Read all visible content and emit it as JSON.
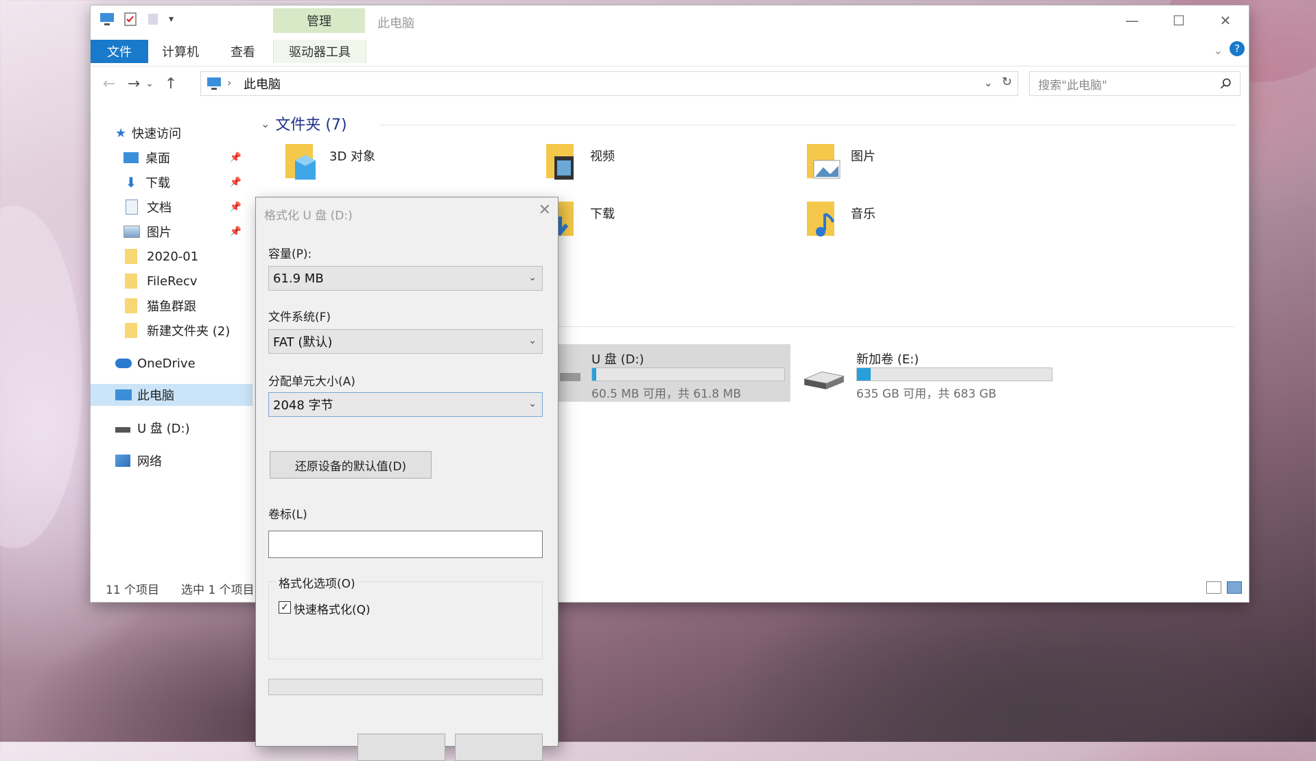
{
  "window": {
    "title": "此电脑",
    "context_tab": "管理",
    "tabs": [
      "文件",
      "计算机",
      "查看",
      "驱动器工具"
    ],
    "address": "此电脑",
    "search_placeholder": "搜索\"此电脑\""
  },
  "nav": {
    "quick_access": "快速访问",
    "items": [
      {
        "label": "桌面",
        "icon": "desktop-icon",
        "pinned": true
      },
      {
        "label": "下载",
        "icon": "download-arrow-icon",
        "pinned": true
      },
      {
        "label": "文档",
        "icon": "document-icon",
        "pinned": true
      },
      {
        "label": "图片",
        "icon": "pictures-icon",
        "pinned": true
      },
      {
        "label": "2020-01",
        "icon": "folder-icon",
        "pinned": false
      },
      {
        "label": "FileRecv",
        "icon": "folder-icon",
        "pinned": false
      },
      {
        "label": "猫鱼群跟",
        "icon": "folder-icon",
        "pinned": false
      },
      {
        "label": "新建文件夹 (2)",
        "icon": "folder-icon",
        "pinned": false
      }
    ],
    "onedrive": "OneDrive",
    "this_pc": "此电脑",
    "usb": "U 盘 (D:)",
    "network": "网络"
  },
  "content": {
    "folders_header": "文件夹 (7)",
    "folders": [
      "3D 对象",
      "视频",
      "图片",
      "下载",
      "音乐"
    ],
    "drives": [
      {
        "name": "U 盘 (D:)",
        "free": "60.5 MB 可用，共 61.8 MB",
        "used_fraction": 0.02
      },
      {
        "name": "新加卷 (E:)",
        "free": "635 GB 可用，共 683 GB",
        "used_fraction": 0.07
      }
    ]
  },
  "status": {
    "count": "11 个项目",
    "selected": "选中 1 个项目"
  },
  "dialog": {
    "title": "格式化 U 盘 (D:)",
    "capacity_label": "容量(P):",
    "capacity_value": "61.9 MB",
    "fs_label": "文件系统(F)",
    "fs_value": "FAT (默认)",
    "alloc_label": "分配单元大小(A)",
    "alloc_value": "2048 字节",
    "restore_btn": "还原设备的默认值(D)",
    "volume_label": "卷标(L)",
    "volume_value": "",
    "options_title": "格式化选项(O)",
    "quick_format": "快速格式化(Q)",
    "quick_checked": true
  },
  "colors": {
    "accent": "#1979ca",
    "context_tab": "#d7e9c7",
    "selection": "#cce4f7",
    "progress": "#26a0da"
  }
}
